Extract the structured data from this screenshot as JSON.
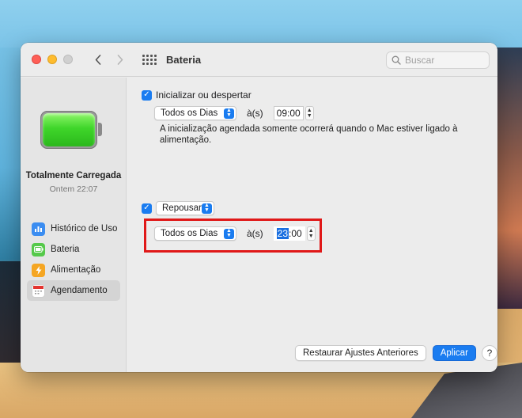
{
  "window": {
    "title": "Bateria",
    "search_placeholder": "Buscar"
  },
  "sidebar": {
    "status_title": "Totalmente Carregada",
    "status_sub": "Ontem 22:07",
    "items": [
      {
        "label": "Histórico de Uso",
        "icon": "bar-chart-icon"
      },
      {
        "label": "Bateria",
        "icon": "battery-icon"
      },
      {
        "label": "Alimentação",
        "icon": "power-bolt-icon"
      },
      {
        "label": "Agendamento",
        "icon": "calendar-icon",
        "selected": true
      }
    ]
  },
  "schedule": {
    "startup": {
      "checkbox_label": "Inicializar ou despertar",
      "checked": true,
      "frequency": "Todos os Dias",
      "at_label": "à(s)",
      "time": "09:00",
      "note": "A inicialização agendada somente ocorrerá quando o Mac estiver ligado à alimentação."
    },
    "sleep": {
      "checked": true,
      "action": "Repousar",
      "frequency": "Todos os Dias",
      "at_label": "à(s)",
      "time_hour": "23",
      "time_rest": ":00"
    }
  },
  "footer": {
    "restore_label": "Restaurar Ajustes Anteriores",
    "apply_label": "Aplicar",
    "help_label": "?"
  },
  "colors": {
    "accent": "#1a7cf0",
    "highlight_box": "#e01818"
  }
}
